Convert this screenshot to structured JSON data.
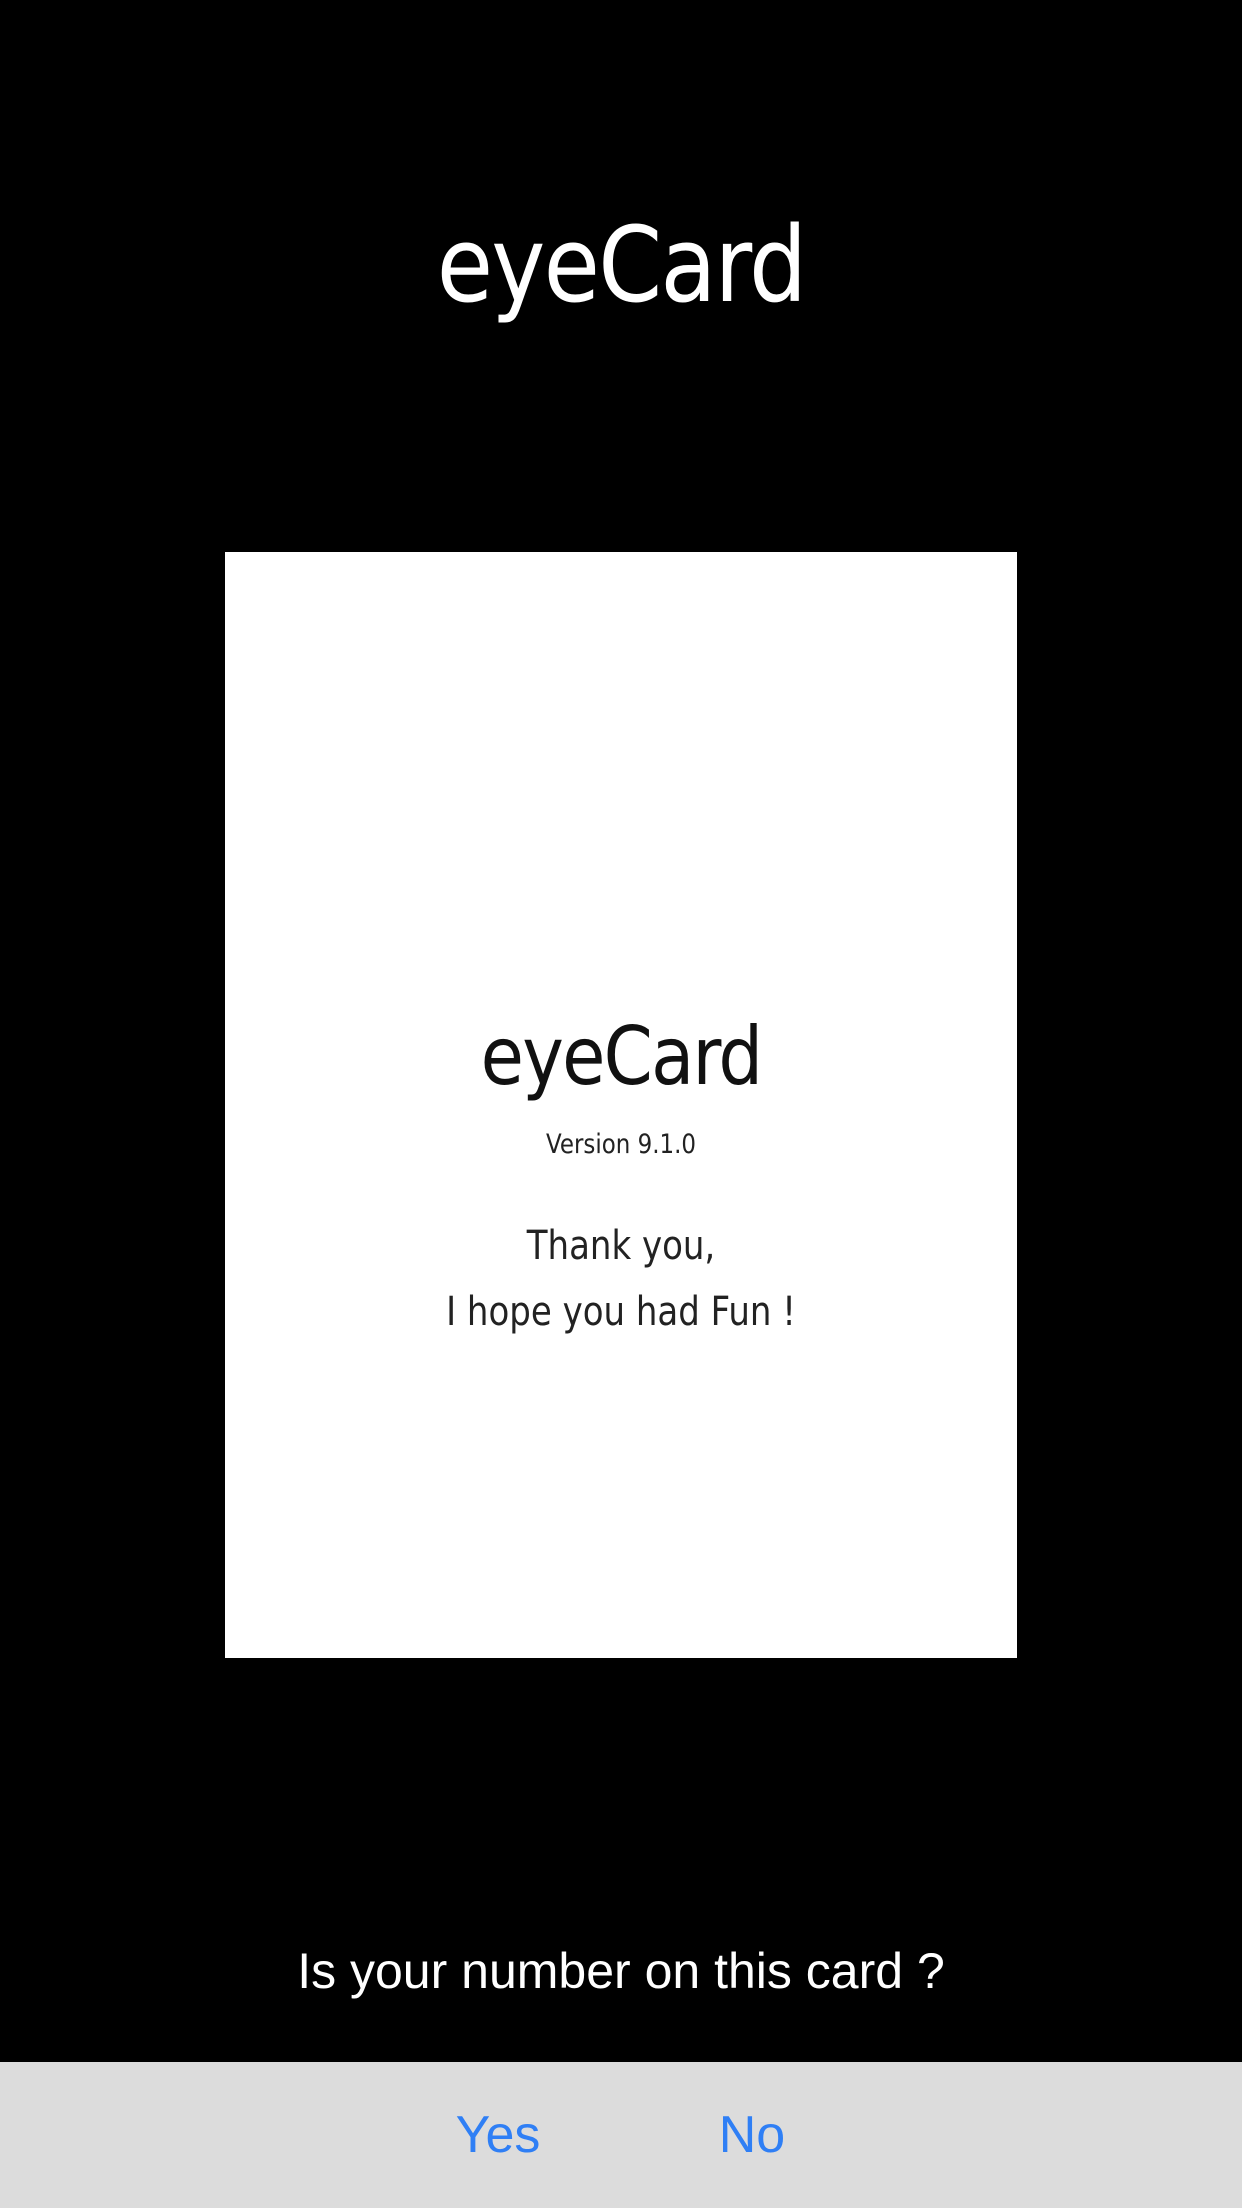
{
  "app": {
    "title": "eyeCard"
  },
  "card": {
    "title": "eyeCard",
    "version": "Version 9.1.0",
    "message_line1": "Thank you,",
    "message_line2": "I hope you had Fun !"
  },
  "prompt": {
    "question": "Is your number on this card ?"
  },
  "actions": {
    "yes_label": "Yes",
    "no_label": "No"
  },
  "colors": {
    "background": "#000000",
    "card": "#ffffff",
    "action_bar": "#dcdcdc",
    "accent": "#2f7ff5"
  }
}
